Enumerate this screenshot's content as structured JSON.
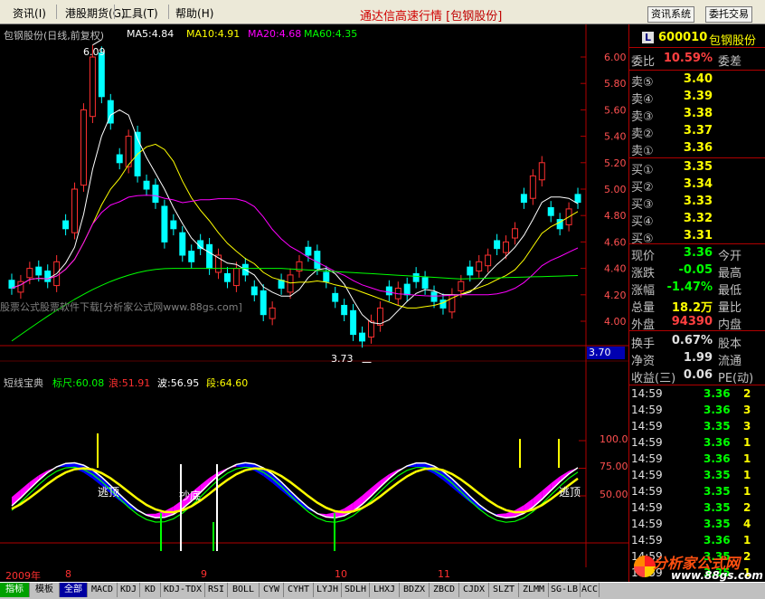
{
  "menu": {
    "items": [
      "资讯",
      "港股期货",
      "工具",
      "帮助"
    ],
    "hotkeys": [
      "(I)",
      "(G)",
      "(T)",
      "(H)"
    ]
  },
  "header": {
    "headline": "通达信高速行情",
    "stock_tag": "[包钢股份]",
    "btn_news": "资讯系统",
    "btn_order": "委托交易"
  },
  "chart": {
    "title": "包钢股份(日线,前复权)",
    "ma": [
      {
        "label": "MA5:4.84",
        "color": "#ffffff"
      },
      {
        "label": "MA10:4.91",
        "color": "#ffff00"
      },
      {
        "label": "MA20:4.68",
        "color": "#ff00ff"
      },
      {
        "label": "MA60:4.35",
        "color": "#00ff00"
      }
    ],
    "high_label": "6.09",
    "low_label": "3.73",
    "price_ticks": [
      "6.00",
      "5.80",
      "5.60",
      "5.40",
      "5.20",
      "5.00",
      "4.80",
      "4.60",
      "4.40",
      "4.20",
      "4.00"
    ],
    "current_price_box": "3.70",
    "watermark": "股票公式股票软件下载[分析家公式网www.88gs.com]",
    "indicator": {
      "name": "短线宝典",
      "vals": [
        {
          "label": "标尺:60.08",
          "color": "#00ff00"
        },
        {
          "label": "浪:51.91",
          "color": "#ff3030"
        },
        {
          "label": "波:56.95",
          "color": "#ffffff"
        },
        {
          "label": "段:64.60",
          "color": "#ffff00"
        }
      ],
      "ticks": [
        "100.0",
        "75.00",
        "50.00"
      ],
      "signals": [
        "逃顶",
        "抄底",
        "逃顶"
      ]
    },
    "time_axis": [
      "2009年",
      "8",
      "9",
      "10",
      "11"
    ]
  },
  "chart_data": {
    "type": "candlestick",
    "title": "包钢股份(日线,前复权)",
    "ylim": [
      3.7,
      6.1
    ],
    "high": 6.09,
    "low": 3.73,
    "ma": {
      "MA5": 4.84,
      "MA10": 4.91,
      "MA20": 4.68,
      "MA60": 4.35
    },
    "price_path": [
      4.25,
      4.3,
      4.4,
      4.35,
      4.3,
      4.45,
      4.7,
      5.0,
      5.6,
      6.0,
      5.7,
      5.5,
      5.2,
      5.4,
      5.1,
      5.0,
      4.9,
      4.6,
      4.7,
      4.5,
      4.45,
      4.55,
      4.4,
      4.5,
      4.3,
      4.4,
      4.35,
      4.2,
      4.05,
      4.1,
      4.25,
      4.35,
      4.45,
      4.5,
      4.4,
      4.3,
      4.15,
      4.05,
      3.9,
      3.85,
      4.0,
      4.1,
      4.2,
      4.25,
      4.2,
      4.3,
      4.25,
      4.15,
      4.1,
      4.2,
      4.3,
      4.35,
      4.45,
      4.5,
      4.55,
      4.6,
      4.7,
      4.9,
      5.1,
      5.2,
      4.8,
      4.7,
      4.85,
      4.9
    ],
    "indicator": {
      "标尺": 60.08,
      "浪": 51.91,
      "波": 56.95,
      "段": 64.6,
      "ylim": [
        20,
        105
      ]
    }
  },
  "panel": {
    "code": "600010",
    "name": "包钢股份",
    "badge": "L",
    "weibi_label": "委比",
    "weibi_value": "10.59%",
    "weicha_label": "委差",
    "sells": [
      {
        "label": "卖⑤",
        "price": "3.40"
      },
      {
        "label": "卖④",
        "price": "3.39"
      },
      {
        "label": "卖③",
        "price": "3.38"
      },
      {
        "label": "卖②",
        "price": "3.37"
      },
      {
        "label": "卖①",
        "price": "3.36"
      }
    ],
    "buys": [
      {
        "label": "买①",
        "price": "3.35"
      },
      {
        "label": "买②",
        "price": "3.34"
      },
      {
        "label": "买③",
        "price": "3.33"
      },
      {
        "label": "买④",
        "price": "3.32"
      },
      {
        "label": "买⑤",
        "price": "3.31"
      }
    ],
    "stats": [
      {
        "k": "现价",
        "v": "3.36",
        "vc": "grn",
        "k2": "今开"
      },
      {
        "k": "涨跌",
        "v": "-0.05",
        "vc": "grn",
        "k2": "最高"
      },
      {
        "k": "涨幅",
        "v": "-1.47%",
        "vc": "grn",
        "k2": "最低"
      },
      {
        "k": "总量",
        "v": "18.2万",
        "vc": "yel",
        "k2": "量比"
      },
      {
        "k": "外盘",
        "v": "94390",
        "vc": "red",
        "k2": "内盘"
      }
    ],
    "stats2": [
      {
        "k": "换手",
        "v": "0.67%",
        "k2": "股本"
      },
      {
        "k": "净资",
        "v": "1.99",
        "k2": "流通"
      },
      {
        "k": "收益(三)",
        "v": "0.06",
        "k2": "PE(动)"
      }
    ],
    "ticks": [
      {
        "t": "14:59",
        "p": "3.36",
        "v": "2"
      },
      {
        "t": "14:59",
        "p": "3.36",
        "v": "3"
      },
      {
        "t": "14:59",
        "p": "3.35",
        "v": "3"
      },
      {
        "t": "14:59",
        "p": "3.36",
        "v": "1"
      },
      {
        "t": "14:59",
        "p": "3.36",
        "v": "1"
      },
      {
        "t": "14:59",
        "p": "3.35",
        "v": "1"
      },
      {
        "t": "14:59",
        "p": "3.35",
        "v": "1"
      },
      {
        "t": "14:59",
        "p": "3.35",
        "v": "2"
      },
      {
        "t": "14:59",
        "p": "3.35",
        "v": "4"
      },
      {
        "t": "14:59",
        "p": "3.36",
        "v": "1"
      },
      {
        "t": "14:59",
        "p": "3.35",
        "v": "2"
      },
      {
        "t": "14:59",
        "p": "3.35",
        "v": "1"
      }
    ],
    "logo_text": "分析家公式网",
    "logo_url": "www.88gs.com"
  },
  "tabs": [
    "指标",
    "模板",
    "全部",
    "MACD",
    "KDJ",
    "KD",
    "KDJ-TDX",
    "RSI",
    "BOLL",
    "CYW",
    "CYHT",
    "LYJH",
    "SDLH",
    "LHXJ",
    "BDZX",
    "ZBCD",
    "CJDX",
    "SLZT",
    "ZLMM",
    "SG-LB",
    "ACC"
  ],
  "colors": {
    "up": "#ff3030",
    "down": "#00ffff",
    "bg": "#000000",
    "panel_border": "#b00000"
  }
}
